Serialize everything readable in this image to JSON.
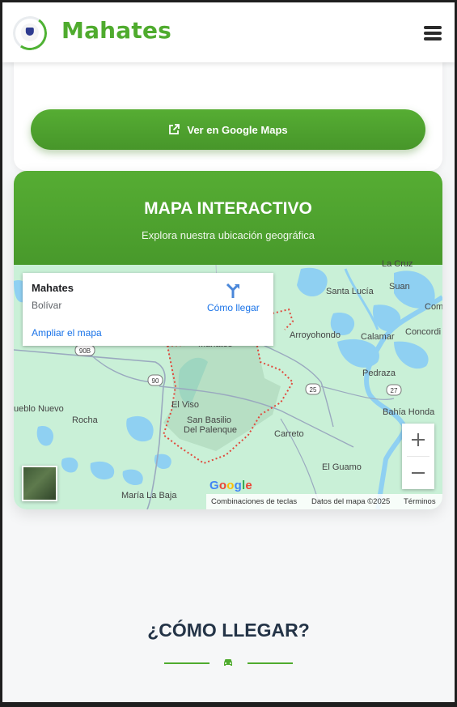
{
  "header": {
    "brand": "Mahates",
    "logo_icon": "municipal-seal-logo",
    "menu_icon": "hamburger-menu-icon",
    "brand_color": "#4fab2e"
  },
  "top_card": {
    "maps_button_label": "Ver en Google Maps",
    "maps_button_icon": "external-link-icon"
  },
  "map_section": {
    "title": "MAPA INTERACTIVO",
    "subtitle": "Explora nuestra ubicación geográfica",
    "accent": "#4fa52f"
  },
  "map": {
    "info_card": {
      "name": "Mahates",
      "region": "Bolívar",
      "directions_label": "Cómo llegar",
      "enlarge_link": "Ampliar el mapa"
    },
    "places": {
      "la_cruz": "La Cruz",
      "santa_lucia": "Santa Lucía",
      "suan": "Suan",
      "como": "Como",
      "arroyohondo": "Arroyohondo",
      "calamar": "Calamar",
      "concordia": "Concordi",
      "mahates": "Mahates",
      "pedraza": "Pedraza",
      "el_viso": "El Viso",
      "pueblo_nuevo": "ueblo Nuevo",
      "rocha": "Rocha",
      "san_basilio_1": "San Basilio",
      "san_basilio_2": "Del Palenque",
      "carreto": "Carreto",
      "bahia_honda": "Bahía Honda",
      "el_guamo": "El Guamo",
      "maria_la_baja": "María La Baja"
    },
    "road_shields": {
      "r90b": "90B",
      "r90": "90",
      "r25": "25",
      "r27": "27"
    },
    "zoom_in_label": "+",
    "zoom_out_label": "−",
    "google_logo": "Google",
    "attribution": {
      "shortcuts": "Combinaciones de teclas",
      "map_data": "Datos del mapa ©2025",
      "terms": "Términos"
    }
  },
  "how_to_arrive": {
    "title": "¿CÓMO LLEGAR?",
    "icon": "car-icon"
  }
}
